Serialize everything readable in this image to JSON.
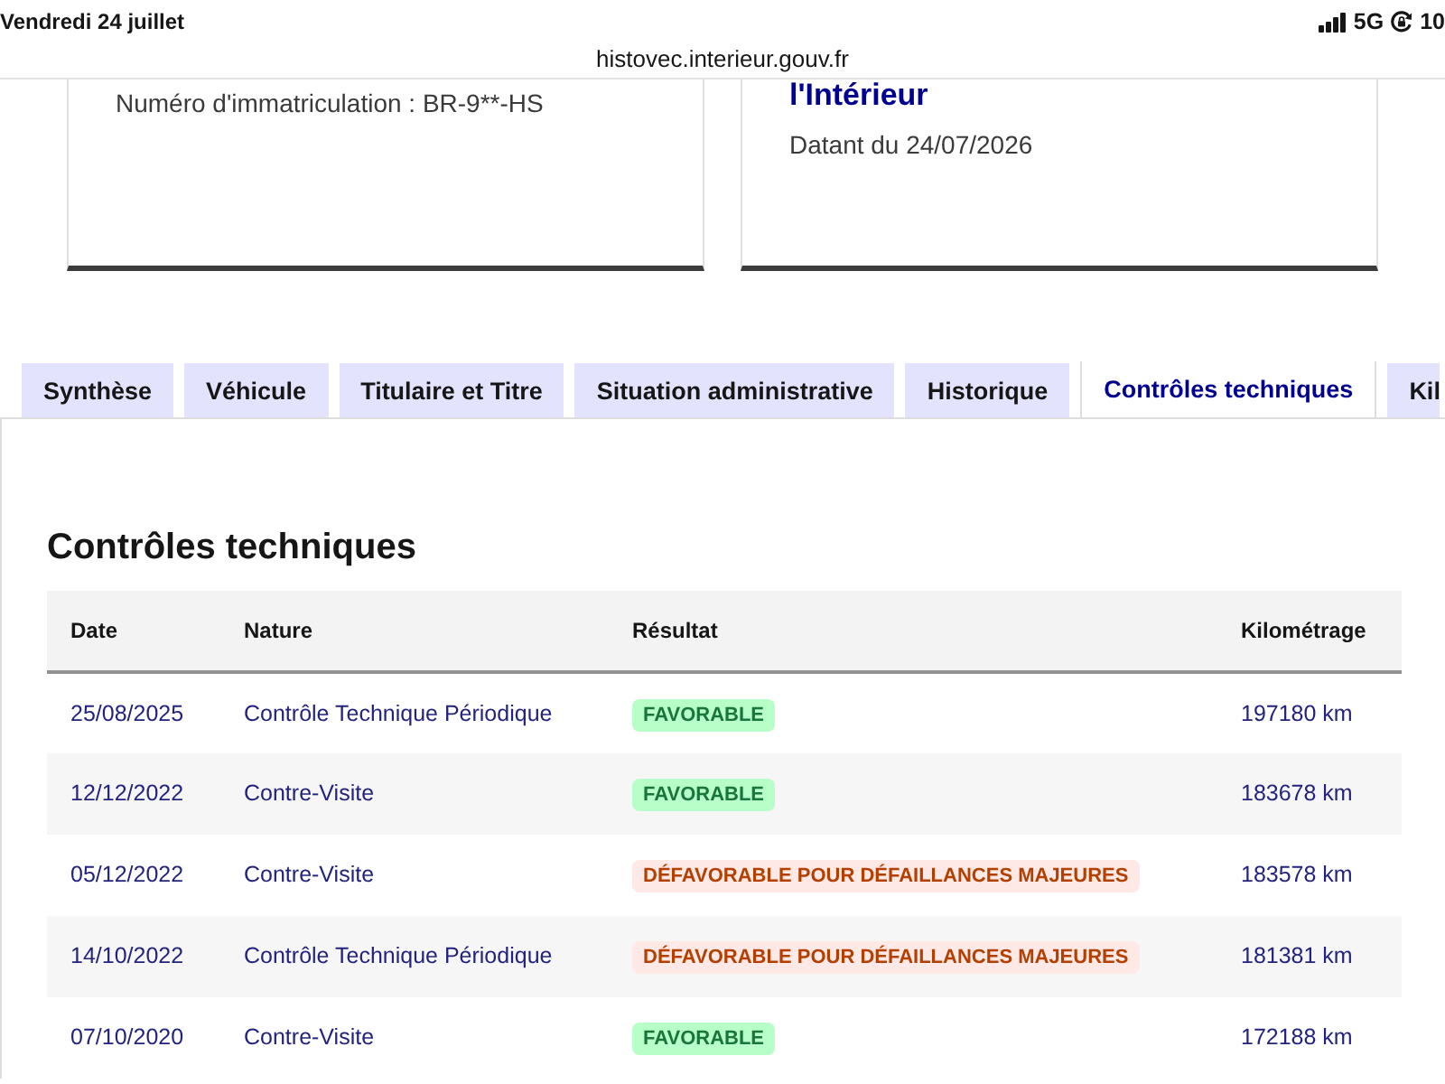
{
  "status_bar": {
    "date": "Vendredi 24 juillet",
    "network": "5G",
    "battery": "10"
  },
  "address_bar": {
    "url": "histovec.interieur.gouv.fr"
  },
  "cards": [
    {
      "lines": [
        {
          "kind": "text",
          "text": "Numéro d'immatriculation : BR-9**-HS"
        }
      ]
    },
    {
      "lines": [
        {
          "kind": "title",
          "text": "l'Intérieur"
        },
        {
          "kind": "text",
          "text": "Datant du 24/07/2026"
        }
      ]
    }
  ],
  "tabs": [
    {
      "label": "Synthèse",
      "selected": false
    },
    {
      "label": "Véhicule",
      "selected": false
    },
    {
      "label": "Titulaire et Titre",
      "selected": false
    },
    {
      "label": "Situation administrative",
      "selected": false
    },
    {
      "label": "Historique",
      "selected": false
    },
    {
      "label": "Contrôles techniques",
      "selected": true
    },
    {
      "label": "Kil",
      "selected": false
    }
  ],
  "section": {
    "title": "Contrôles techniques",
    "table": {
      "columns": [
        "Date",
        "Nature",
        "Résultat",
        "Kilométrage"
      ],
      "rows": [
        {
          "date": "25/08/2025",
          "nature": "Contrôle Technique Périodique",
          "result": {
            "text": "FAVORABLE",
            "kind": "success"
          },
          "mileage": "197180 km"
        },
        {
          "date": "12/12/2022",
          "nature": "Contre-Visite",
          "result": {
            "text": "FAVORABLE",
            "kind": "success"
          },
          "mileage": "183678 km"
        },
        {
          "date": "05/12/2022",
          "nature": "Contre-Visite",
          "result": {
            "text": "DÉFAVORABLE POUR DÉFAILLANCES MAJEURES",
            "kind": "error"
          },
          "mileage": "183578 km"
        },
        {
          "date": "14/10/2022",
          "nature": "Contrôle Technique Périodique",
          "result": {
            "text": "DÉFAVORABLE POUR DÉFAILLANCES MAJEURES",
            "kind": "error"
          },
          "mileage": "181381 km"
        },
        {
          "date": "07/10/2020",
          "nature": "Contre-Visite",
          "result": {
            "text": "FAVORABLE",
            "kind": "success"
          },
          "mileage": "172188 km"
        }
      ]
    }
  }
}
